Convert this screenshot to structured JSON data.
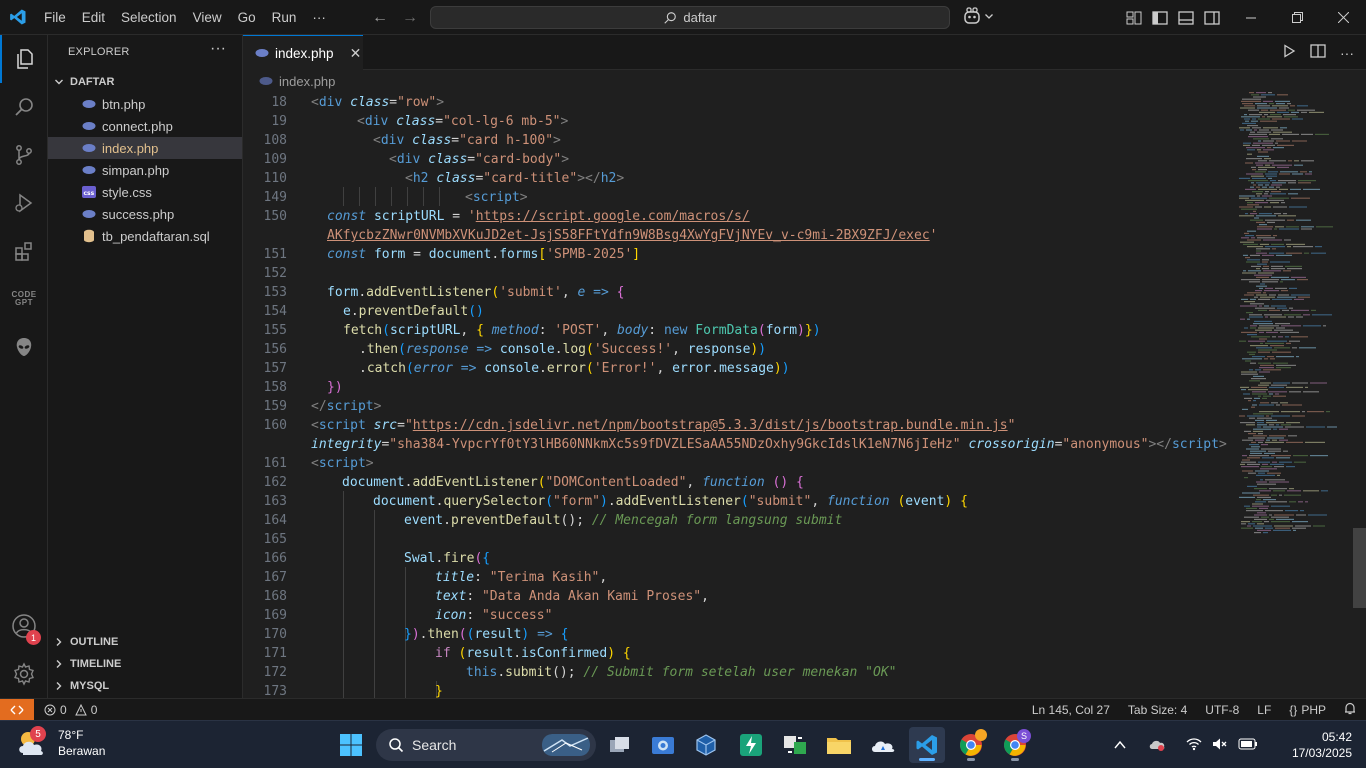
{
  "titlebar": {
    "menu": [
      "File",
      "Edit",
      "Selection",
      "View",
      "Go",
      "Run",
      "···"
    ],
    "search_text": "daftar",
    "icons": [
      "vscode-logo-icon",
      "arrow-left-icon",
      "arrow-right-icon",
      "search-icon",
      "copilot-icon",
      "chevron-down-icon",
      "customize-layout-icon",
      "toggle-primary-sidebar-icon",
      "toggle-panel-icon",
      "toggle-secondary-sidebar-icon"
    ],
    "window_controls": [
      "minimize",
      "restore",
      "close"
    ]
  },
  "activitybar": {
    "items": [
      "explorer-icon",
      "search-icon",
      "source-control-icon",
      "run-debug-icon",
      "extensions-icon",
      "codegpt-icon",
      "alien-icon",
      "accounts-icon",
      "manage-gear-icon"
    ],
    "accounts_badge": "1",
    "codegpt_label": "CODE GPT"
  },
  "sidebar": {
    "title": "EXPLORER",
    "more": "···",
    "folder": "DAFTAR",
    "files": [
      {
        "name": "btn.php",
        "icon": "php-icon"
      },
      {
        "name": "connect.php",
        "icon": "php-icon"
      },
      {
        "name": "index.php",
        "icon": "php-icon",
        "selected": true
      },
      {
        "name": "simpan.php",
        "icon": "php-icon"
      },
      {
        "name": "style.css",
        "icon": "css-icon"
      },
      {
        "name": "success.php",
        "icon": "php-icon"
      },
      {
        "name": "tb_pendaftaran.sql",
        "icon": "database-icon"
      }
    ],
    "sections": [
      "OUTLINE",
      "TIMELINE",
      "MYSQL"
    ]
  },
  "tab": {
    "name": "index.php",
    "close": "✕"
  },
  "breadcrumb": {
    "file": "index.php"
  },
  "editor": {
    "line_numbers": [
      "18",
      "19",
      "108",
      "109",
      "110",
      "149",
      "150",
      "",
      "151",
      "152",
      "153",
      "154",
      "155",
      "156",
      "157",
      "158",
      "159",
      "160",
      "",
      "161",
      "162",
      "163",
      "164",
      "165",
      "166",
      "167",
      "168",
      "169",
      "170",
      "171",
      "172",
      "173"
    ],
    "code": {
      "l18": [
        "<",
        "div",
        " ",
        "class",
        "=",
        "\"row\"",
        ">"
      ],
      "l19": [
        "<",
        "div",
        " ",
        "class",
        "=",
        "\"col-lg-6 mb-5\"",
        ">"
      ],
      "l108": [
        "<",
        "div",
        " ",
        "class",
        "=",
        "\"card h-100\"",
        ">"
      ],
      "l109": [
        "<",
        "div",
        " ",
        "class",
        "=",
        "\"card-body\"",
        ">"
      ],
      "l110": [
        "<",
        "h2",
        " ",
        "class",
        "=",
        "\"card-title\"",
        "></",
        "h2",
        ">"
      ],
      "l149": [
        "<",
        "script",
        ">"
      ],
      "l150a": [
        "const",
        " ",
        "scriptURL",
        " = ",
        "'",
        "https://script.google.com/macros/s/"
      ],
      "l150b": [
        "AKfycbzZNwr0NVMbXVKuJD2et-JsjS58FFtYdfn9W8Bsg4XwYgFVjNYEv_v-c9mi-2BX9ZFJ/exec",
        "'"
      ],
      "l151": [
        "const",
        " ",
        "form",
        " = ",
        "document",
        ".",
        "forms",
        "[",
        "'SPMB-2025'",
        "]"
      ],
      "l153": [
        "form",
        ".",
        "addEventListener",
        "(",
        "'submit'",
        ", ",
        "e",
        " ",
        "=>",
        " ",
        "{"
      ],
      "l154": [
        "e",
        ".",
        "preventDefault",
        "()"
      ],
      "l155": [
        "fetch",
        "(",
        "scriptURL",
        ", ",
        "{",
        " ",
        "method",
        ": ",
        "'POST'",
        ", ",
        "body",
        ": ",
        "new",
        " ",
        "FormData",
        "(",
        "form",
        ")",
        "}",
        ")"
      ],
      "l156": [
        ".",
        "then",
        "(",
        "response",
        " ",
        "=>",
        " ",
        "console",
        ".",
        "log",
        "(",
        "'Success!'",
        ", ",
        "response",
        ")",
        ")"
      ],
      "l157": [
        ".",
        "catch",
        "(",
        "error",
        " ",
        "=>",
        " ",
        "console",
        ".",
        "error",
        "(",
        "'Error!'",
        ", ",
        "error",
        ".",
        "message",
        ")",
        ")"
      ],
      "l158": [
        "})"
      ],
      "l159": [
        "</",
        "script",
        ">"
      ],
      "l160a": [
        "<",
        "script",
        " ",
        "src",
        "=",
        "\"",
        "https://cdn.jsdelivr.net/npm/bootstrap@5.3.3/dist/js/bootstrap.bundle.min.js",
        "\""
      ],
      "l160b": [
        "integrity",
        "=",
        "\"sha384-YvpcrYf0tY3lHB60NNkmXc5s9fDVZLESaAA55NDzOxhy9GkcIdslK1eN7N6jIeHz\"",
        " ",
        "crossorigin",
        "=",
        "\"anonymous\"",
        "></",
        "script",
        ">"
      ],
      "l161": [
        "<",
        "script",
        ">"
      ],
      "l162": [
        "document",
        ".",
        "addEventListener",
        "(",
        "\"DOMContentLoaded\"",
        ", ",
        "function",
        " ",
        "()",
        " ",
        "{"
      ],
      "l163": [
        "document",
        ".",
        "querySelector",
        "(",
        "\"form\"",
        ")",
        ".",
        "addEventListener",
        "(",
        "\"submit\"",
        ", ",
        "function",
        " ",
        "(",
        "event",
        ")",
        " ",
        "{"
      ],
      "l164": [
        "event",
        ".",
        "preventDefault",
        "();",
        " ",
        "// Mencegah form langsung submit"
      ],
      "l166": [
        "Swal",
        ".",
        "fire",
        "(",
        "{"
      ],
      "l167": [
        "title",
        ": ",
        "\"Terima Kasih\"",
        ","
      ],
      "l168": [
        "text",
        ": ",
        "\"Data Anda Akan Kami Proses\"",
        ","
      ],
      "l169": [
        "icon",
        ": ",
        "\"success\""
      ],
      "l170": [
        "}",
        ")",
        ".",
        "then",
        "(",
        "(",
        "result",
        ")",
        " ",
        "=>",
        " ",
        "{"
      ],
      "l171": [
        "if",
        " ",
        "(",
        "result",
        ".",
        "isConfirmed",
        ")",
        " ",
        "{"
      ],
      "l172": [
        "this",
        ".",
        "submit",
        "();",
        " ",
        "// Submit form setelah user menekan \"OK\""
      ],
      "l173": [
        "}"
      ]
    }
  },
  "statusbar": {
    "remote_icon": "remote-icon",
    "errors": "0",
    "warnings": "0",
    "position": "Ln 145, Col 27",
    "tab_size": "Tab Size: 4",
    "encoding": "UTF-8",
    "eol": "LF",
    "language_braces": "{}",
    "language": "PHP",
    "notifications_icon": "bell-icon"
  },
  "taskbar": {
    "weather_temp": "78°F",
    "weather_desc": "Berawan",
    "weather_badge": "5",
    "search_placeholder": "Search",
    "apps": [
      "windows-start-icon",
      "search-icon",
      "task-view-icon",
      "capture-icon",
      "virtualbox-icon",
      "power-icon",
      "sync-icon",
      "file-explorer-icon",
      "onedrive-cloud-icon",
      "vscode-icon",
      "chrome-icon",
      "chrome-profile-icon"
    ],
    "chrome_profile_badge": "S",
    "time": "05:42",
    "date": "17/03/2025"
  }
}
